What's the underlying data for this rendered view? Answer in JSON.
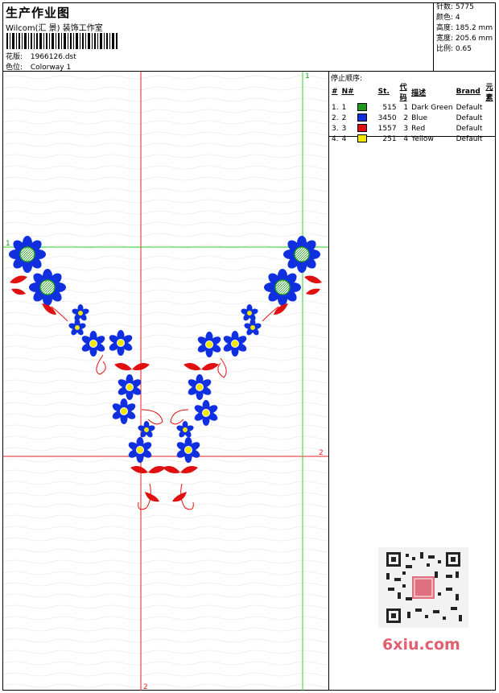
{
  "header": {
    "title": "生产作业图",
    "company": "Wilcom(汇 景) 装饰工作室",
    "design_label": "花版:",
    "design_value": "1966126.dst",
    "colorway_label": "色位:",
    "colorway_value": "Colorway 1"
  },
  "stats": [
    {
      "label": "针数:",
      "value": "5775"
    },
    {
      "label": "颜色:",
      "value": "4"
    },
    {
      "label": "高度:",
      "value": "185.2 mm"
    },
    {
      "label": "宽度:",
      "value": "205.6 mm"
    },
    {
      "label": "比例:",
      "value": "0.65"
    }
  ],
  "legend": {
    "stop_label": "停止顺序:",
    "columns": [
      "#",
      "N#",
      "St.",
      "代码",
      "描述",
      "Brand",
      "元素"
    ],
    "rows": [
      {
        "idx": "1.",
        "n": "1",
        "color": "#1a9a1a",
        "st": "515",
        "code": "1",
        "desc": "Dark Green",
        "brand": "Default"
      },
      {
        "idx": "2.",
        "n": "2",
        "color": "#1030e0",
        "st": "3450",
        "code": "2",
        "desc": "Blue",
        "brand": "Default"
      },
      {
        "idx": "3.",
        "n": "3",
        "color": "#e01010",
        "st": "1557",
        "code": "3",
        "desc": "Red",
        "brand": "Default"
      },
      {
        "idx": "4.",
        "n": "4",
        "color": "#f0e800",
        "st": "251",
        "code": "4",
        "desc": "Yellow",
        "brand": "Default"
      }
    ]
  },
  "canvas": {
    "guide_top_right": "1",
    "guide_left": "1",
    "guide_right_mid": "2",
    "guide_bottom": "2"
  },
  "watermark": "6xiu.com",
  "colors": {
    "blue": "#1030e0",
    "red": "#e01010",
    "green": "#1a9a1a",
    "yellow": "#f0e800",
    "guide_green": "#30d030",
    "guide_red": "#e02020"
  }
}
